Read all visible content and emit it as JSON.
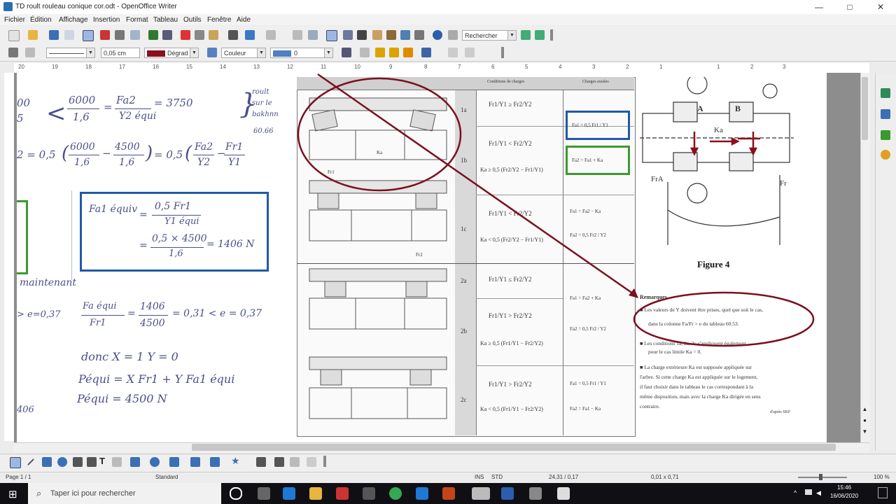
{
  "window": {
    "title": "TD roult rouleau conique cor.odt - OpenOffice Writer",
    "minimize": "—",
    "maximize": "□",
    "close": "✕"
  },
  "menu": [
    "Fichier",
    "Édition",
    "Affichage",
    "Insertion",
    "Format",
    "Tableau",
    "Outils",
    "Fenêtre",
    "Aide"
  ],
  "toolbar": {
    "search_placeholder": "Rechercher",
    "line_width": "0,05 cm",
    "color_name": "Dégrad",
    "fill_type": "Couleur",
    "fill_value": "0"
  },
  "ruler_numbers": [
    "20",
    "19",
    "18",
    "17",
    "16",
    "15",
    "14",
    "13",
    "12",
    "11",
    "10",
    "9",
    "8",
    "7",
    "6",
    "5",
    "4",
    "3",
    "2",
    "1",
    "1",
    "2",
    "3"
  ],
  "document": {
    "left_top": {
      "frac1_num": "6000",
      "frac1_den": "1,6",
      "frac2_num": "Fa2",
      "frac2_den": "Y2 équi",
      "result": "3750",
      "fragment_left_a": "00",
      "fragment_left_b": "5",
      "side_note_1": "roult",
      "side_note_2": "sur le",
      "side_note_3": "bakhnn",
      "side_note_4": "60.66"
    },
    "left_second": {
      "lead": "2 = 0,5",
      "t1_num": "6000",
      "t1_den": "1,6",
      "t2_num": "4500",
      "t2_den": "1,6",
      "mid": "= 0,5",
      "t3_num": "Fa2",
      "t3_den": "Y2",
      "t4_num": "Fr1",
      "t4_den": "Y1"
    },
    "boxed": {
      "lhs": "Fa1 équiv",
      "f1_num": "0,5 Fr1",
      "f1_den": "Y1 équi",
      "f2_num": "0,5 × 4500",
      "f2_den": "1,6",
      "result": "= 1406 N"
    },
    "maintenant": "maintenant",
    "ratio": {
      "lhs_frag": "e=0,37",
      "num": "Fa équi",
      "den": "Fr1",
      "n2": "1406",
      "d2": "4500",
      "cmp": "= 0,31 < e = 0,37"
    },
    "donc": "donc X = 1     Y = 0",
    "p_line1": "Péqui = X Fr1 + Y Fa1 équi",
    "p_line2": "Péqui = 4500 N",
    "frag_406": "406",
    "table": {
      "col_cases": "Conditions de charges",
      "col_loads": "Charges axiales",
      "rows": [
        "1a",
        "1b",
        "1c",
        "2a",
        "2b",
        "2c"
      ],
      "cond_1a": "Fr1/Y1 ≥ Fr2/Y2",
      "cond_1b_a": "Fr1/Y1 < Fr2/Y2",
      "cond_1b_b": "Ka ≥ 0,5 (Fr2/Y2 − Fr1/Y1)",
      "cond_1c_a": "Fr1/Y1 < Fr2/Y2",
      "cond_1c_b": "Ka < 0,5 (Fr2/Y2 − Fr1/Y1)",
      "cond_2a": "Fr1/Y1 ≤ Fr2/Y2",
      "cond_2b_a": "Fr1/Y1 > Fr2/Y2",
      "cond_2b_b": "Ka ≥ 0,5 (Fr1/Y1 − Fr2/Y2)",
      "cond_2c_a": "Fr1/Y1 > Fr2/Y2",
      "cond_2c_b": "Ka < 0,5 (Fr1/Y1 − Fr2/Y2)",
      "load_1": "Fa1 = 0,5 Fr1 / Y1",
      "load_2": "Fa2 = Fa1 + Ka",
      "load_3": "Fa1 = Fa2 − Ka",
      "load_4": "Fa2 = 0,5 Fr2 / Y2",
      "load_5": "Fa1 = Fa2 + Ka",
      "load_6": "Fa2 = 0,5 Fr2 / Y2",
      "load_7": "Fa1 = 0,5 Fr1 / Y1",
      "load_8": "Fa2 = Fa1 − Ka",
      "bearing_label": "Ka",
      "fr1": "Fr1",
      "fr2": "Fr2"
    },
    "figure": {
      "label_a": "A",
      "label_b": "B",
      "label_ka": "Ka",
      "label_fr_a": "FrA",
      "label_fr_b": "Fr",
      "caption": "Figure 4"
    },
    "remarks": {
      "heading": "Remarques",
      "p1a": "■ Les valeurs de Y doivent être prises, quel que soit le cas,",
      "p1b": "dans la colonne Fa/Fr > e  du tableau 60.53.",
      "p2a": "■ Les conditions 1a, 2a, 2c s'appliquent également",
      "p2b": "pour le cas limite Ka = 0.",
      "p3a": "■ La charge extérieure Ka est supposée appliquée sur",
      "p3b": "l'arbre. Si cette charge Ka est appliquée sur le logement,",
      "p3c": "il faut choisir dans le tableau le cas correspondant à la",
      "p3d": "même disposition, mais avec la charge Ka dirigée en sens",
      "p3e": "contraire.",
      "source": "d'après SKF"
    }
  },
  "status": {
    "page": "Page 1 / 1",
    "style": "Standard",
    "ins": "INS",
    "std": "STD",
    "position": "24,31 / 0,17",
    "size": "0,01 x 0,71",
    "zoom": "100 %"
  },
  "taskbar": {
    "search_placeholder": "Taper ici pour rechercher",
    "time": "15:46",
    "date": "16/06/2020"
  },
  "colors": {
    "accent_red": "#7a1020",
    "box_blue": "#1f5aa6",
    "box_green": "#3a9a2e",
    "ink": "#4a4f8a"
  }
}
